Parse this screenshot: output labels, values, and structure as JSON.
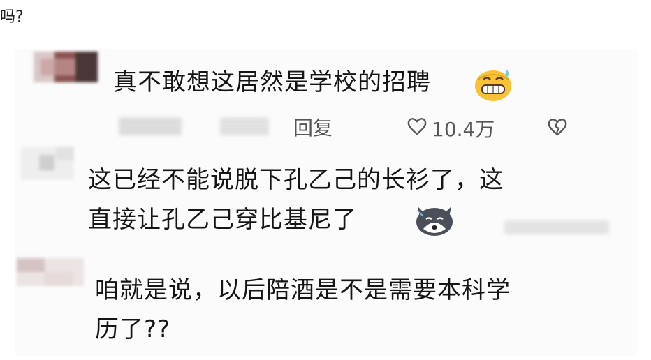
{
  "header": {
    "partial_text": "吗?"
  },
  "comments": [
    {
      "text": "真不敢想这居然是学校的招聘",
      "emoji": "grinning-sweat-emoji",
      "reply_label": "回复",
      "likes": "10.4万"
    },
    {
      "line1": "这已经不能说脱下孔乙己的长衫了，这",
      "line2": "直接让孔乙己穿比基尼了",
      "emoji": "husky-dog-emoji"
    },
    {
      "line1": "咱就是说，以后陪酒是不是需要本科学",
      "line2": "历了??"
    }
  ],
  "colors": {
    "background": "#ffffff",
    "card": "#fbfbfb",
    "text": "#151515",
    "meta": "#555555"
  }
}
